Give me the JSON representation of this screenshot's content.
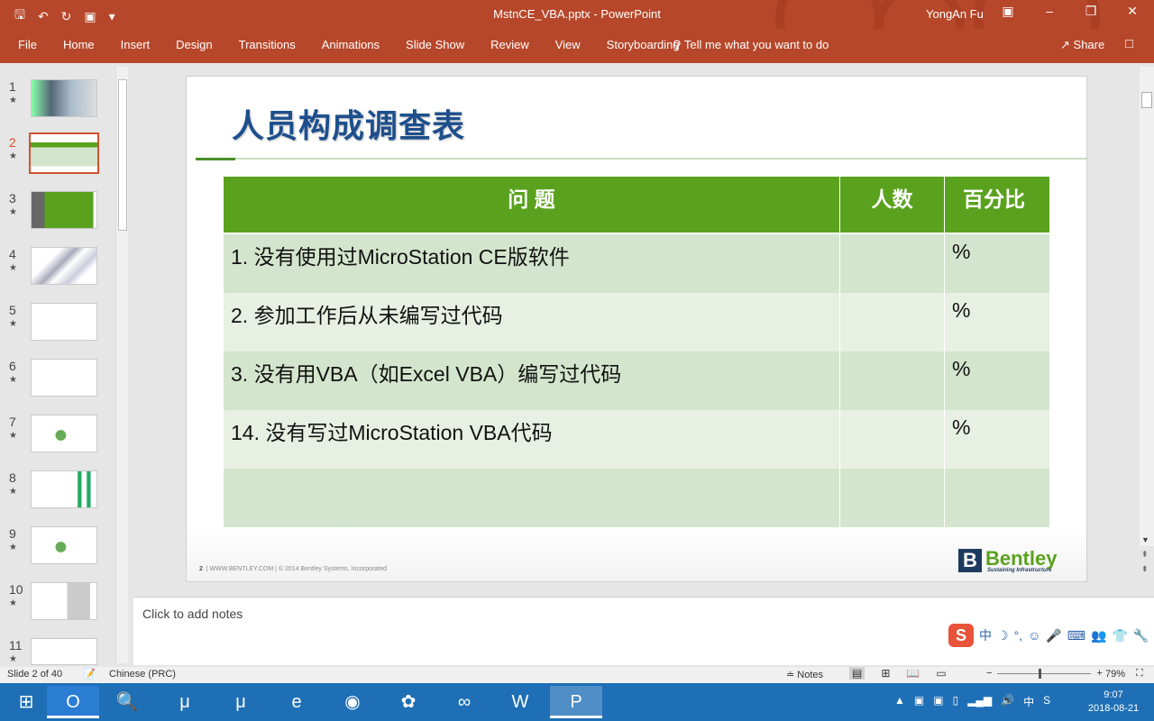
{
  "titlebar": {
    "doc": "MstnCE_VBA.pptx  -  PowerPoint",
    "user": "YongAn Fu"
  },
  "ribbon": {
    "tabs": [
      "File",
      "Home",
      "Insert",
      "Design",
      "Transitions",
      "Animations",
      "Slide Show",
      "Review",
      "View",
      "Storyboarding"
    ],
    "tell": "Tell me what you want to do",
    "share": "Share"
  },
  "thumbnails": [
    "1",
    "2",
    "3",
    "4",
    "5",
    "6",
    "7",
    "8",
    "9",
    "10",
    "11"
  ],
  "slide": {
    "title": "人员构成调查表",
    "headers": [
      "问  题",
      "人数",
      "百分比"
    ],
    "rows": [
      {
        "q": "1. 没有使用过MicroStation CE版软件",
        "n": "",
        "p": "%"
      },
      {
        "q": "2. 参加工作后从未编写过代码",
        "n": "",
        "p": "%"
      },
      {
        "q": "3. 没有用VBA（如Excel VBA）编写过代码",
        "n": "",
        "p": "%"
      },
      {
        "q": "14. 没有写过MicroStation VBA代码",
        "n": "",
        "p": "%"
      },
      {
        "q": "",
        "n": "",
        "p": ""
      }
    ],
    "footer_num": "2",
    "footer_text": "|   WWW.BENTLEY.COM   |   © 2014 Bentley Systems, Incorporated",
    "logo_name": "Bentley",
    "logo_tag": "Sustaining Infrastructure"
  },
  "notes_placeholder": "Click to add notes",
  "status": {
    "slide": "Slide 2 of 40",
    "language": "Chinese (PRC)",
    "notes_btn": "Notes",
    "zoom": "79%"
  },
  "clock": {
    "time": "9:07",
    "date": "2018-08-21"
  },
  "colors": {
    "accent": "#b7472a",
    "table_header": "#5aa21e",
    "title": "#1d4f8c"
  }
}
